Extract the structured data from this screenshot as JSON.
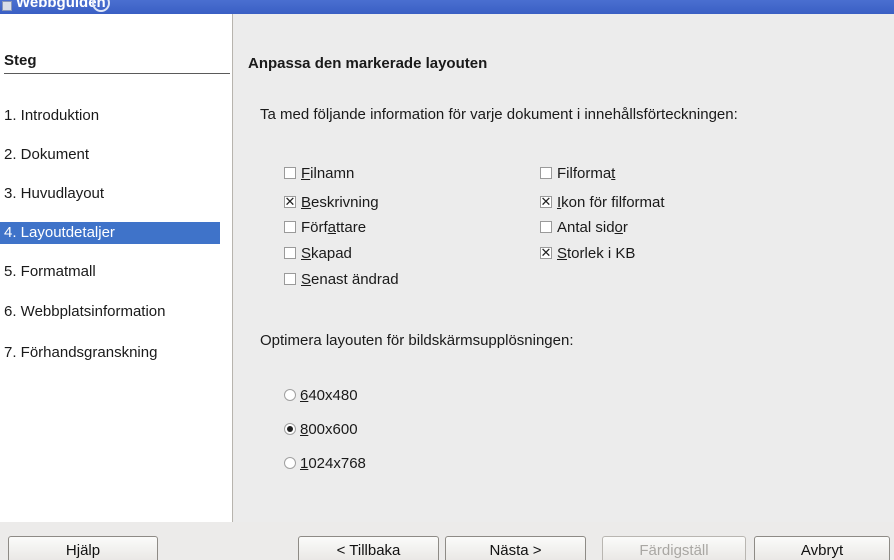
{
  "window": {
    "title": "Webbguiden"
  },
  "sidebar": {
    "title": "Steg",
    "steps": [
      {
        "label": "1. Introduktion"
      },
      {
        "label": "2. Dokument"
      },
      {
        "label": "3. Huvudlayout"
      },
      {
        "label": "4. Layoutdetaljer",
        "selected": true
      },
      {
        "label": "5. Formatmall"
      },
      {
        "label": "6. Webbplatsinformation"
      },
      {
        "label": "7. Förhandsgranskning"
      }
    ]
  },
  "main": {
    "heading": "Anpassa den markerade layouten",
    "info_label": "Ta med följande information för varje dokument i innehållsförteckningen:",
    "checkboxes": [
      {
        "pre": "",
        "accel": "F",
        "post": "ilnamn",
        "checked": false
      },
      {
        "pre": "",
        "accel": "B",
        "post": "eskrivning",
        "checked": true
      },
      {
        "pre": "Förf",
        "accel": "a",
        "post": "ttare",
        "checked": false
      },
      {
        "pre": "",
        "accel": "S",
        "post": "kapad",
        "checked": false
      },
      {
        "pre": "",
        "accel": "S",
        "post": "enast ändrad",
        "checked": false
      },
      {
        "pre": "Filforma",
        "accel": "t",
        "post": "",
        "checked": false
      },
      {
        "pre": "",
        "accel": "I",
        "post": "kon för filformat",
        "checked": true
      },
      {
        "pre": "Antal sid",
        "accel": "o",
        "post": "r",
        "checked": false
      },
      {
        "pre": "",
        "accel": "S",
        "post": "torlek i KB",
        "checked": true
      }
    ],
    "resolution_label": "Optimera layouten för bildskärmsupplösningen:",
    "resolutions": [
      {
        "accel": "6",
        "post": "40x480",
        "selected": false
      },
      {
        "accel": "8",
        "post": "00x600",
        "selected": true
      },
      {
        "accel": "1",
        "post": "024x768",
        "selected": false
      }
    ]
  },
  "buttons": {
    "help": "Hjälp",
    "back": "< Tillbaka",
    "next": "Nästa >",
    "finish": "Färdigställ",
    "cancel": "Avbryt"
  },
  "colors": {
    "titlebar": "#3a5fc4",
    "selection": "#3f73c9"
  }
}
